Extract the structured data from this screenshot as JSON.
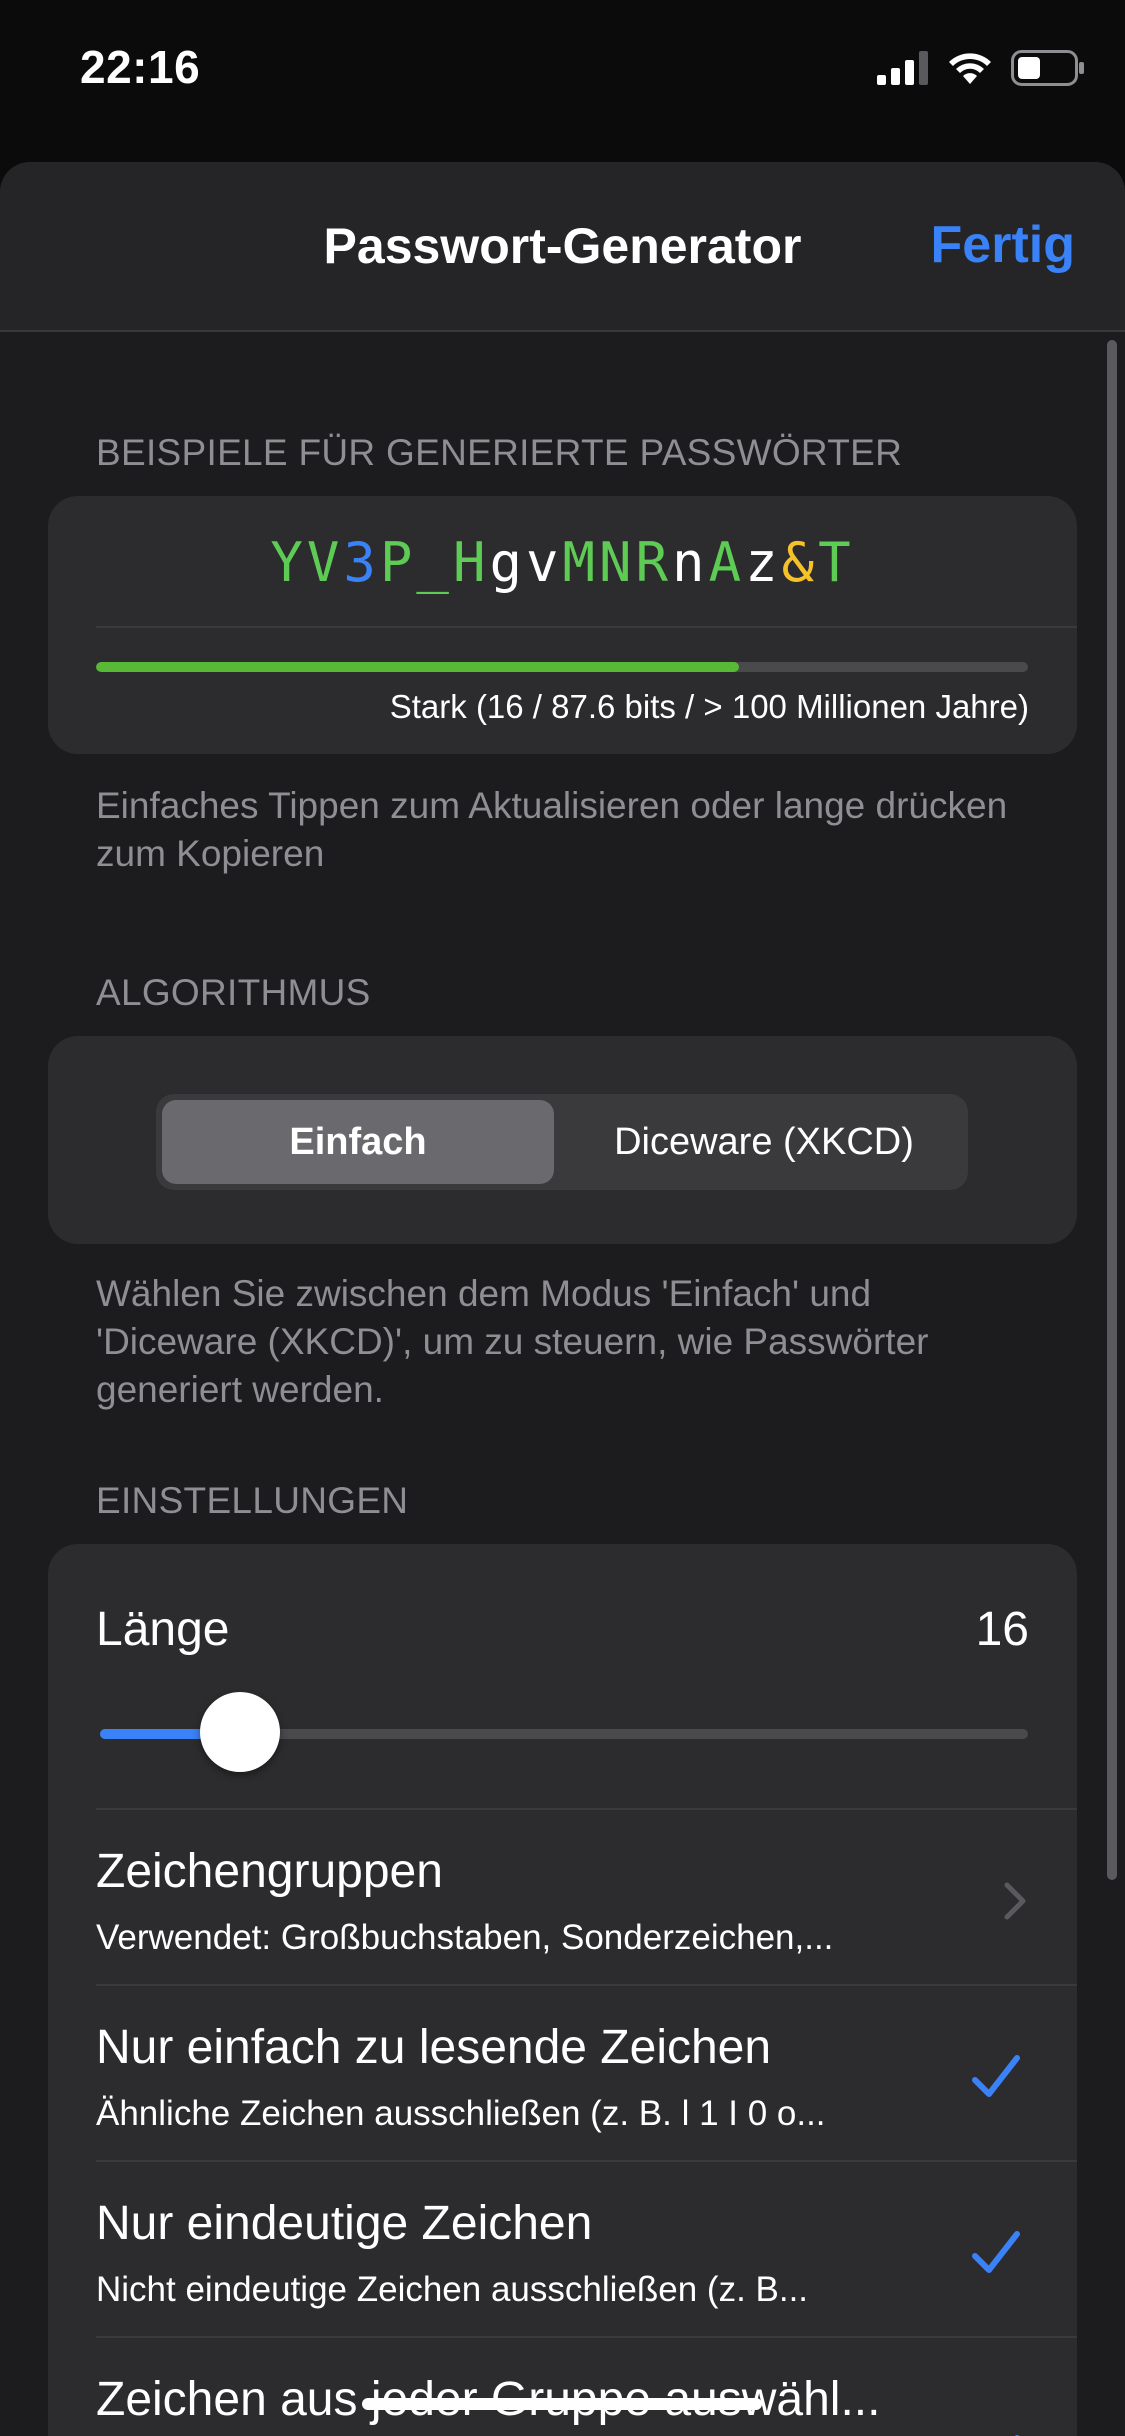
{
  "status_bar": {
    "time": "22:16",
    "icons": [
      "signal-icon",
      "wifi-icon",
      "battery-icon"
    ]
  },
  "nav": {
    "title": "Passwort-Generator",
    "done_label": "Fertig"
  },
  "examples": {
    "header": "BEISPIELE FÜR GENERIERTE PASSWÖRTER",
    "password_segments": [
      {
        "text": "YV",
        "color": "#5ecb54"
      },
      {
        "text": "3",
        "color": "#3a82f7"
      },
      {
        "text": "P_H",
        "color": "#5ecb54"
      },
      {
        "text": "gv",
        "color": "#ffffff"
      },
      {
        "text": "MNR",
        "color": "#5ecb54"
      },
      {
        "text": "n",
        "color": "#ffffff"
      },
      {
        "text": "A",
        "color": "#5ecb54"
      },
      {
        "text": "z",
        "color": "#ffffff"
      },
      {
        "text": "&",
        "color": "#f5c22a"
      },
      {
        "text": "T",
        "color": "#5ecb54"
      }
    ],
    "strength_fraction": 0.69,
    "strength_color": "#57b935",
    "strength_label": "Stark (16 / 87.6 bits / > 100 Millionen Jahre)",
    "footer": "Einfaches Tippen zum Aktualisieren oder lange drücken zum Kopieren"
  },
  "algorithm": {
    "header": "ALGORITHMUS",
    "options": [
      "Einfach",
      "Diceware (XKCD)"
    ],
    "selected": "Einfach",
    "footer": "Wählen Sie zwischen dem Modus 'Einfach' und 'Diceware (XKCD)', um zu steuern, wie Passwörter generiert werden."
  },
  "settings": {
    "header": "EINSTELLUNGEN",
    "length": {
      "label": "Länge",
      "value": "16",
      "slider_fraction": 0.16
    },
    "rows": [
      {
        "title": "Zeichengruppen",
        "subtitle": "Verwendet: Großbuchstaben, Sonderzeichen,...",
        "accessory": "chevron-right-icon"
      },
      {
        "title": "Nur einfach zu lesende Zeichen",
        "subtitle": "Ähnliche Zeichen ausschließen (z. B. l 1 I 0 o...",
        "accessory": "checkmark-icon",
        "checked": true
      },
      {
        "title": "Nur eindeutige Zeichen",
        "subtitle": "Nicht eindeutige Zeichen ausschließen (z. B...",
        "accessory": "checkmark-icon",
        "checked": true
      },
      {
        "title": "Zeichen aus jeder Gruppe auswähl...",
        "accessory": "checkmark-icon",
        "checked": true
      }
    ]
  },
  "colors": {
    "accent": "#3a82f7",
    "sheet_bg": "#1c1c1e",
    "card_bg": "#2c2c2e",
    "secondary_text": "#8e8e93"
  }
}
